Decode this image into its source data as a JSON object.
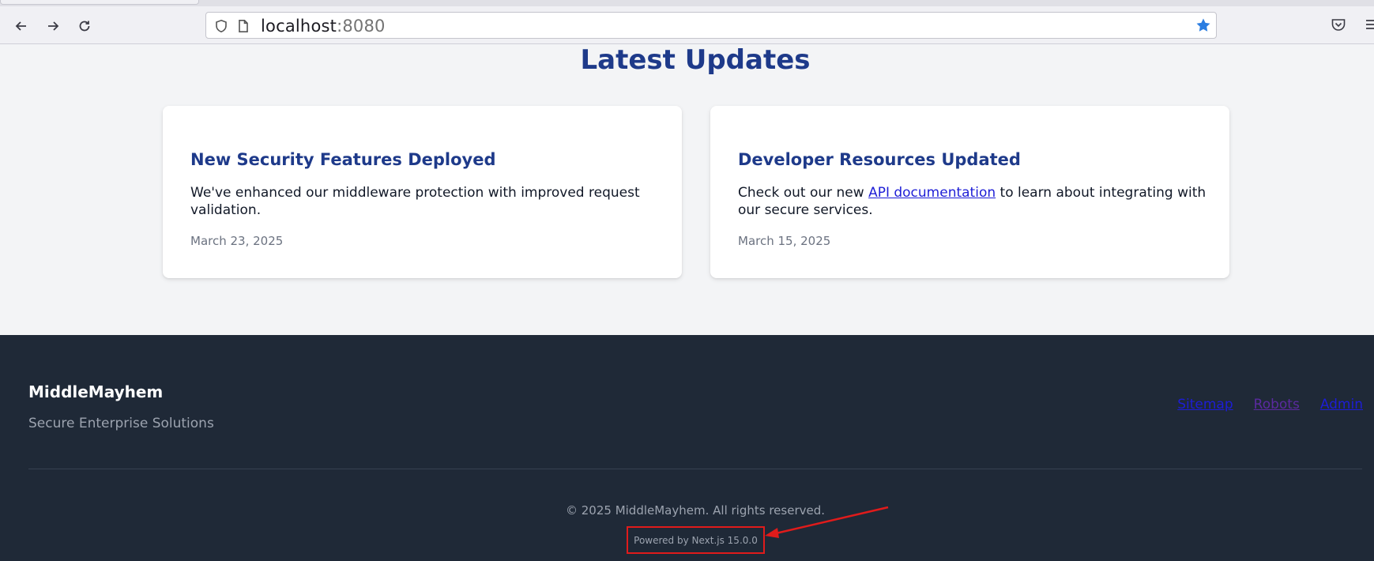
{
  "browser": {
    "url_host": "localhost",
    "url_port": ":8080",
    "icons": [
      "back-icon",
      "forward-icon",
      "reload-icon",
      "shield-icon",
      "page-icon",
      "bookmark-star-icon",
      "pocket-icon",
      "menu-icon"
    ]
  },
  "main": {
    "section_title": "Latest Updates",
    "cards": [
      {
        "title": "New Security Features Deployed",
        "body": "We've enhanced our middleware protection with improved request validation.",
        "date": "March 23, 2025"
      },
      {
        "title": "Developer Resources Updated",
        "body_before": "Check out our new ",
        "body_link": "API documentation",
        "body_after": " to learn about integrating with our secure services.",
        "date": "March 15, 2025"
      }
    ]
  },
  "footer": {
    "brand": "MiddleMayhem",
    "tagline": "Secure Enterprise Solutions",
    "links": [
      "Sitemap",
      "Robots",
      "Admin"
    ],
    "copyright": "© 2025 MiddleMayhem. All rights reserved.",
    "powered_by": "Powered by Next.js 15.0.0"
  },
  "colors": {
    "heading": "#1e3a8a",
    "footer_bg": "#1f2937",
    "annotation": "#e01b1b",
    "link": "#1d1dd6"
  }
}
